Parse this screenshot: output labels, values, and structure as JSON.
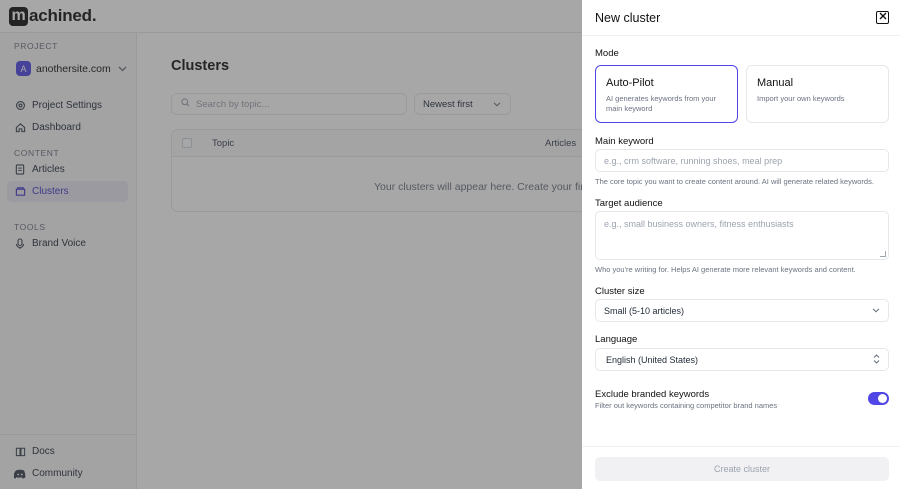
{
  "brand": {
    "logo_letter": "m",
    "logo_rest": "achined",
    "logo_dot": "."
  },
  "sidebar": {
    "project_section": "PROJECT",
    "project_avatar": "A",
    "project_name": "anothersite.com",
    "items_top": [
      {
        "label": "Project Settings",
        "icon": "settings-icon"
      },
      {
        "label": "Dashboard",
        "icon": "home-icon"
      }
    ],
    "content_section": "CONTENT",
    "items_content": [
      {
        "label": "Articles",
        "icon": "document-icon"
      },
      {
        "label": "Clusters",
        "icon": "folder-icon",
        "active": true
      }
    ],
    "tools_section": "TOOLS",
    "items_tools": [
      {
        "label": "Brand Voice",
        "icon": "microphone-icon"
      }
    ],
    "items_bottom": [
      {
        "label": "Docs",
        "icon": "book-icon"
      },
      {
        "label": "Community",
        "icon": "discord-icon"
      }
    ]
  },
  "main": {
    "title": "Clusters",
    "search_placeholder": "Search by topic...",
    "sort_value": "Newest first",
    "table": {
      "col_topic": "Topic",
      "col_articles": "Articles",
      "empty_text": "Your clusters will appear here. Create your first"
    }
  },
  "drawer": {
    "title": "New cluster",
    "mode_label": "Mode",
    "modes": [
      {
        "title": "Auto-Pilot",
        "desc": "AI generates keywords from your main keyword",
        "selected": true
      },
      {
        "title": "Manual",
        "desc": "Import your own keywords",
        "selected": false
      }
    ],
    "main_keyword_label": "Main keyword",
    "main_keyword_placeholder": "e.g., crm software, running shoes, meal prep",
    "main_keyword_help": "The core topic you want to create content around. AI will generate related keywords.",
    "audience_label": "Target audience",
    "audience_placeholder": "e.g., small business owners, fitness enthusiasts",
    "audience_help": "Who you're writing for. Helps AI generate more relevant keywords and content.",
    "cluster_size_label": "Cluster size",
    "cluster_size_value": "Small (5-10 articles)",
    "language_label": "Language",
    "language_value": "English (United States)",
    "exclude_title": "Exclude branded keywords",
    "exclude_desc": "Filter out keywords containing competitor brand names",
    "exclude_on": true,
    "create_button": "Create cluster"
  },
  "colors": {
    "accent": "#4f46e5",
    "active_nav_bg": "#e8e8f3"
  }
}
